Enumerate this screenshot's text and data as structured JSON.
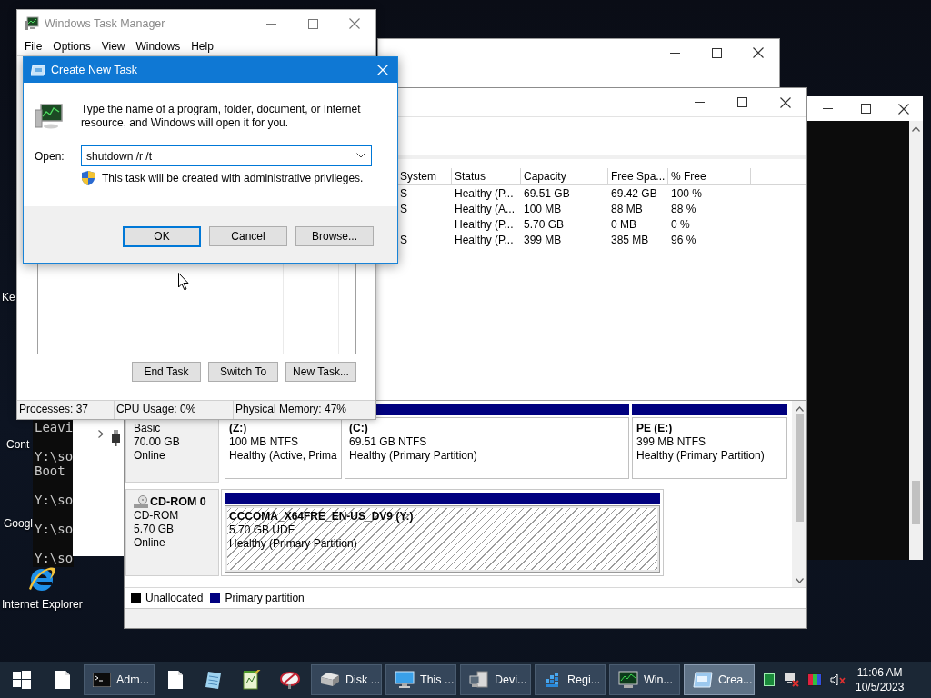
{
  "desktop": {
    "icons": [
      {
        "label": "Ke",
        "kind": "label"
      },
      {
        "label": "Cont",
        "kind": "label"
      },
      {
        "label": "Googl",
        "kind": "label"
      },
      {
        "label": "Internet Explorer",
        "kind": "browser"
      }
    ]
  },
  "console": {
    "lines": [
      "Leavi",
      "Y:\\so",
      "Boot",
      "Y:\\so",
      "Y:\\so",
      "Y:\\so"
    ]
  },
  "disk_management": {
    "table": {
      "columns": [
        "System",
        "Status",
        "Capacity",
        "Free Spa...",
        "% Free"
      ],
      "rows": [
        {
          "system": "S",
          "status": "Healthy (P...",
          "capacity": "69.51 GB",
          "free_space": "69.42 GB",
          "percent_free": "100 %"
        },
        {
          "system": "S",
          "status": "Healthy (A...",
          "capacity": "100 MB",
          "free_space": "88 MB",
          "percent_free": "88 %"
        },
        {
          "status": "Healthy (P...",
          "capacity": "5.70 GB",
          "free_space": "0 MB",
          "percent_free": "0 %"
        },
        {
          "system": "S",
          "status": "Healthy (P...",
          "capacity": "399 MB",
          "free_space": "385 MB",
          "percent_free": "96 %"
        }
      ]
    },
    "disks": [
      {
        "kind": "basic",
        "info": [
          "Basic",
          "70.00 GB",
          "Online"
        ],
        "partitions": [
          {
            "label": "(Z:)",
            "size": "100 MB NTFS",
            "status": "Healthy (Active, Prima",
            "selected": false
          },
          {
            "label": "(C:)",
            "size": "69.51 GB NTFS",
            "status": "Healthy (Primary Partition)",
            "selected": false
          },
          {
            "label": "PE  (E:)",
            "size": "399 MB NTFS",
            "status": "Healthy (Primary Partition)",
            "selected": false
          }
        ]
      },
      {
        "kind": "cdrom",
        "name": "CD-ROM 0",
        "info": [
          "CD-ROM",
          "5.70 GB",
          "Online"
        ],
        "partitions": [
          {
            "label": "CCCOMA_X64FRE_EN-US_DV9  (Y:)",
            "size": "5.70 GB UDF",
            "status": "Healthy (Primary Partition)",
            "selected": true
          }
        ]
      }
    ],
    "legend": [
      {
        "label": "Unallocated",
        "color": "#000000"
      },
      {
        "label": "Primary partition",
        "color": "#000080"
      }
    ]
  },
  "task_manager": {
    "title": "Windows Task Manager",
    "active": false,
    "menu": [
      "File",
      "Options",
      "View",
      "Windows",
      "Help"
    ],
    "buttons": [
      "End Task",
      "Switch To",
      "New Task..."
    ],
    "status_bar": [
      "Processes: 37",
      "CPU Usage: 0%",
      "Physical Memory: 47%"
    ]
  },
  "create_new_task": {
    "title": "Create New Task",
    "message": "Type the name of a program, folder, document, or Internet resource, and Windows will open it for you.",
    "open_label": "Open:",
    "open_value": "shutdown /r /t",
    "note": "This task will be created with administrative privileges.",
    "buttons": [
      {
        "label": "OK",
        "default": true
      },
      {
        "label": "Cancel",
        "default": false
      },
      {
        "label": "Browse...",
        "default": false
      }
    ]
  },
  "taskbar": {
    "items": [
      {
        "kind": "start",
        "selected": false
      },
      {
        "kind": "file",
        "selected": false
      },
      {
        "kind": "console",
        "label": "Adm...",
        "selected": false
      },
      {
        "kind": "file",
        "selected": false
      },
      {
        "kind": "notepad",
        "selected": false
      },
      {
        "kind": "editor",
        "selected": false
      },
      {
        "kind": "network",
        "selected": false
      },
      {
        "kind": "disk",
        "label": "Disk ...",
        "selected": false
      },
      {
        "kind": "computer",
        "label": "This ...",
        "selected": false
      },
      {
        "kind": "devices",
        "label": "Devi...",
        "selected": false
      },
      {
        "kind": "registry",
        "label": "Regi...",
        "selected": false
      },
      {
        "kind": "taskmgr",
        "label": "Win...",
        "selected": false
      },
      {
        "kind": "dialog",
        "label": "Crea...",
        "selected": true
      }
    ],
    "clock": {
      "time": "11:06 AM",
      "date": "10/5/2023"
    }
  }
}
